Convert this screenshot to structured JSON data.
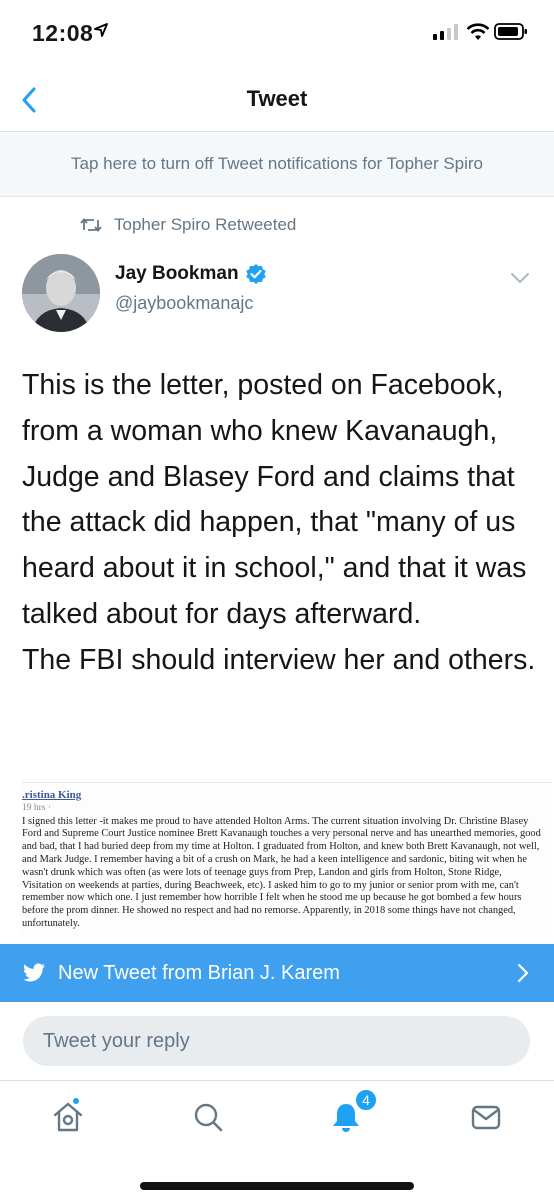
{
  "status_bar": {
    "time": "12:08"
  },
  "nav": {
    "title": "Tweet"
  },
  "notification_banner": "Tap here to turn off Tweet notifications for Topher Spiro",
  "retweet_info": "Topher Spiro Retweeted",
  "tweet": {
    "author_name": "Jay Bookman",
    "author_handle": "@jaybookmanajc",
    "text": "This is the letter, posted on Facebook, from a woman who knew Kavanaugh, Judge and Blasey Ford and claims that the attack did happen, that \"many of us heard about it in school,\" and that it was talked about for days afterward.\nThe FBI should interview her and others.",
    "image": {
      "name": ".ristina King",
      "time": "19 hrs ·",
      "body": "I signed this letter -it makes me proud to have attended Holton Arms. The current situation involving Dr. Christine Blasey Ford and Supreme Court Justice nominee Brett Kavanaugh touches a very personal nerve and has unearthed memories, good and bad, that I had buried deep from my time at Holton. I graduated from Holton, and knew both Brett Kavanaugh, not well, and Mark Judge. I remember having a bit of a crush on Mark, he had a keen intelligence and sardonic, biting wit when he wasn't drunk which was often (as were lots of teenage guys from Prep, Landon and girls from Holton, Stone Ridge, Visitation on weekends at parties, during Beachweek, etc). I asked him to go to my junior or senior prom with me, can't remember now which one. I just remember how horrible I felt when he stood me up because he got bombed a few hours before the prom dinner. He showed no respect and had no remorse. Apparently, in 2018 some things have not changed, unfortunately."
    }
  },
  "new_tweet_banner": "New Tweet from Brian J. Karem",
  "reply": {
    "placeholder": "Tweet your reply"
  },
  "tab_bar": {
    "notification_count": "4"
  },
  "colors": {
    "twitter_blue": "#1da1f2",
    "banner_blue": "#3fa0ef",
    "secondary_text": "#657786"
  }
}
